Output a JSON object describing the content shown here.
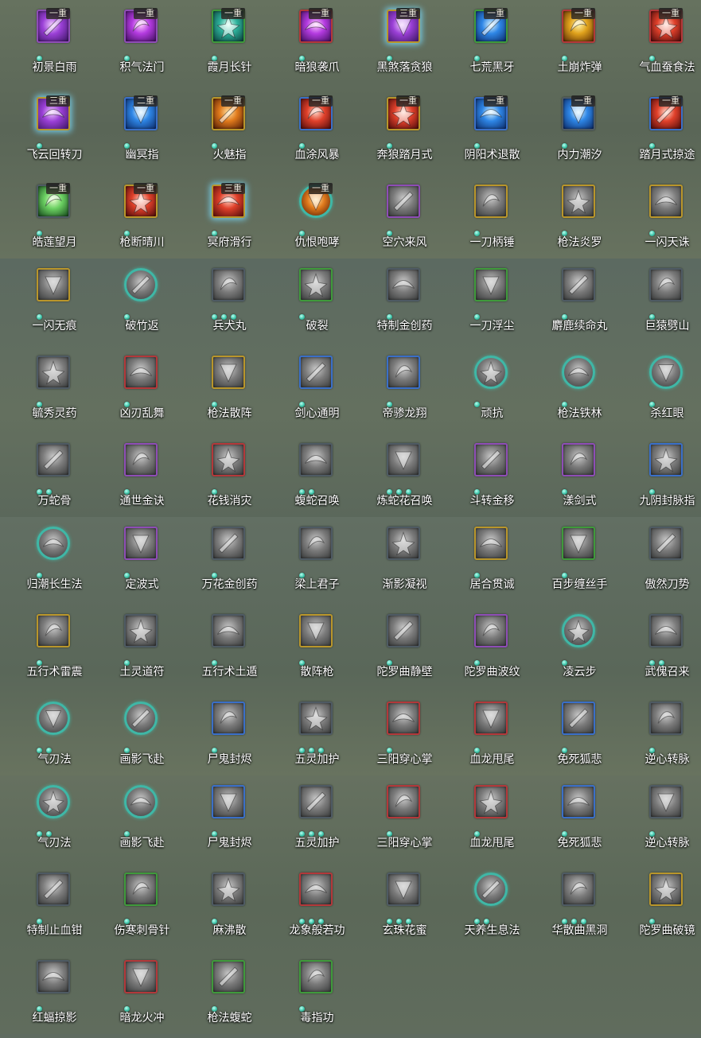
{
  "skills": [
    {
      "name": "初景白雨",
      "rank": "一重",
      "dots": 1,
      "border": "purple",
      "tone": "c-purple",
      "shape": "round-blank",
      "glow": false
    },
    {
      "name": "积气法门",
      "rank": "一重",
      "dots": 1,
      "border": "purple",
      "tone": "c-magenta",
      "glow": false
    },
    {
      "name": "霞月长针",
      "rank": "一重",
      "dots": 1,
      "border": "green",
      "tone": "c-teal",
      "glow": false
    },
    {
      "name": "暗狼袭爪",
      "rank": "一重",
      "dots": 1,
      "border": "red",
      "tone": "c-magenta",
      "glow": false
    },
    {
      "name": "黑煞落贪狼",
      "rank": "三重",
      "dots": 1,
      "border": "gold",
      "tone": "c-purple",
      "glow": true
    },
    {
      "name": "七荒黑牙",
      "rank": "一重",
      "dots": 1,
      "border": "green",
      "tone": "c-blue",
      "glow": false
    },
    {
      "name": "土崩炸弹",
      "rank": "一重",
      "dots": 1,
      "border": "red",
      "tone": "c-gold",
      "glow": false
    },
    {
      "name": "气血蚕食法",
      "rank": "一重",
      "dots": 1,
      "border": "red",
      "tone": "c-red",
      "glow": false
    },
    {
      "name": "飞云回转刀",
      "rank": "三重",
      "dots": 1,
      "border": "gold",
      "tone": "c-purple",
      "glow": true
    },
    {
      "name": "幽冥指",
      "rank": "二重",
      "dots": 1,
      "border": "blue",
      "tone": "c-blue",
      "glow": false
    },
    {
      "name": "火魅指",
      "rank": "一重",
      "dots": 1,
      "border": "gold",
      "tone": "c-orange",
      "glow": false
    },
    {
      "name": "血涂风暴",
      "rank": "一重",
      "dots": 1,
      "border": "blue",
      "tone": "c-red",
      "glow": false
    },
    {
      "name": "奔狼踏月式",
      "rank": "一重",
      "dots": 1,
      "border": "gold",
      "tone": "c-red",
      "glow": false
    },
    {
      "name": "阴阳术退散",
      "rank": "一重",
      "dots": 1,
      "border": "blue",
      "tone": "c-blue",
      "glow": false
    },
    {
      "name": "内力潮汐",
      "rank": "一重",
      "dots": 1,
      "border": "gray",
      "tone": "c-blue",
      "glow": false
    },
    {
      "name": "踏月式掠途",
      "rank": "一重",
      "dots": 1,
      "border": "blue",
      "tone": "c-red",
      "glow": false
    },
    {
      "name": "皓莲望月",
      "rank": "一重",
      "dots": 1,
      "border": "gray",
      "tone": "c-green",
      "glow": false
    },
    {
      "name": "枪断晴川",
      "rank": "一重",
      "dots": 1,
      "border": "gold",
      "tone": "c-red",
      "glow": false
    },
    {
      "name": "冥府滑行",
      "rank": "三重",
      "dots": 1,
      "border": "gold",
      "tone": "c-red",
      "glow": true
    },
    {
      "name": "仇恨咆哮",
      "rank": "一重",
      "dots": 1,
      "border": "round",
      "tone": "c-orange",
      "glow": false
    },
    {
      "name": "空穴来风",
      "rank": "",
      "dots": 1,
      "border": "purple",
      "tone": "",
      "glow": false
    },
    {
      "name": "一刀柄锤",
      "rank": "",
      "dots": 1,
      "border": "gold",
      "tone": "",
      "glow": false
    },
    {
      "name": "枪法炎罗",
      "rank": "",
      "dots": 1,
      "border": "gold",
      "tone": "",
      "glow": false
    },
    {
      "name": "一闪天诛",
      "rank": "",
      "dots": 1,
      "border": "gold",
      "tone": "",
      "glow": false
    },
    {
      "name": "一闪无痕",
      "rank": "",
      "dots": 1,
      "border": "gold",
      "tone": "",
      "glow": false
    },
    {
      "name": "破竹返",
      "rank": "",
      "dots": 1,
      "border": "round",
      "tone": "",
      "glow": false
    },
    {
      "name": "兵犬丸",
      "rank": "",
      "dots": 3,
      "border": "gray",
      "tone": "",
      "glow": false
    },
    {
      "name": "破裂",
      "rank": "",
      "dots": 1,
      "border": "green",
      "tone": "",
      "glow": false
    },
    {
      "name": "特制金创药",
      "rank": "",
      "dots": 1,
      "border": "gray",
      "tone": "",
      "glow": false
    },
    {
      "name": "一刀浮尘",
      "rank": "",
      "dots": 1,
      "border": "green",
      "tone": "",
      "glow": false
    },
    {
      "name": "麝鹿续命丸",
      "rank": "",
      "dots": 1,
      "border": "gray",
      "tone": "",
      "glow": false
    },
    {
      "name": "巨猿劈山",
      "rank": "",
      "dots": 1,
      "border": "gray",
      "tone": "",
      "glow": false
    },
    {
      "name": "毓秀灵药",
      "rank": "",
      "dots": 1,
      "border": "gray",
      "tone": "",
      "glow": false
    },
    {
      "name": "凶刃乱舞",
      "rank": "",
      "dots": 1,
      "border": "red",
      "tone": "",
      "glow": false
    },
    {
      "name": "枪法散阵",
      "rank": "",
      "dots": 1,
      "border": "gold",
      "tone": "",
      "glow": false
    },
    {
      "name": "剑心通明",
      "rank": "",
      "dots": 1,
      "border": "blue",
      "tone": "",
      "glow": false
    },
    {
      "name": "帝骖龙翔",
      "rank": "",
      "dots": 1,
      "border": "blue",
      "tone": "",
      "glow": false
    },
    {
      "name": "顽抗",
      "rank": "",
      "dots": 1,
      "border": "round",
      "tone": "",
      "glow": false
    },
    {
      "name": "枪法铁林",
      "rank": "",
      "dots": 1,
      "border": "round",
      "tone": "",
      "glow": false
    },
    {
      "name": "杀红眼",
      "rank": "",
      "dots": 1,
      "border": "round",
      "tone": "",
      "glow": false
    },
    {
      "name": "万蛇骨",
      "rank": "",
      "dots": 2,
      "border": "gray",
      "tone": "",
      "glow": false
    },
    {
      "name": "通世金诀",
      "rank": "",
      "dots": 1,
      "border": "purple",
      "tone": "",
      "glow": false
    },
    {
      "name": "花钱消灾",
      "rank": "",
      "dots": 1,
      "border": "red",
      "tone": "",
      "glow": false
    },
    {
      "name": "蝮蛇召唤",
      "rank": "",
      "dots": 2,
      "border": "gray",
      "tone": "",
      "glow": false
    },
    {
      "name": "炼蛇花召唤",
      "rank": "",
      "dots": 3,
      "border": "gray",
      "tone": "",
      "glow": false
    },
    {
      "name": "斗转金移",
      "rank": "",
      "dots": 1,
      "border": "purple",
      "tone": "",
      "glow": false
    },
    {
      "name": "漾剑式",
      "rank": "",
      "dots": 1,
      "border": "purple",
      "tone": "",
      "glow": false
    },
    {
      "name": "九阴封脉指",
      "rank": "",
      "dots": 1,
      "border": "blue",
      "tone": "",
      "glow": false
    },
    {
      "name": "归潮长生法",
      "rank": "",
      "dots": 1,
      "border": "round",
      "tone": "",
      "glow": false
    },
    {
      "name": "定波式",
      "rank": "",
      "dots": 1,
      "border": "purple",
      "tone": "",
      "glow": false
    },
    {
      "name": "万花金创药",
      "rank": "",
      "dots": 1,
      "border": "gray",
      "tone": "",
      "glow": false
    },
    {
      "name": "梁上君子",
      "rank": "",
      "dots": 1,
      "border": "gray",
      "tone": "",
      "glow": false
    },
    {
      "name": "渐影凝视",
      "rank": "",
      "dots": 0,
      "border": "gray",
      "tone": "",
      "glow": false
    },
    {
      "name": "居合贯诚",
      "rank": "",
      "dots": 1,
      "border": "gold",
      "tone": "",
      "glow": false
    },
    {
      "name": "百步缠丝手",
      "rank": "",
      "dots": 1,
      "border": "green",
      "tone": "",
      "glow": false
    },
    {
      "name": "傲然刀势",
      "rank": "",
      "dots": 0,
      "border": "gray",
      "tone": "",
      "glow": false
    },
    {
      "name": "五行术雷震",
      "rank": "",
      "dots": 1,
      "border": "gold",
      "tone": "",
      "glow": false
    },
    {
      "name": "土灵道符",
      "rank": "",
      "dots": 1,
      "border": "gray",
      "tone": "",
      "glow": false
    },
    {
      "name": "五行术土遁",
      "rank": "",
      "dots": 1,
      "border": "gray",
      "tone": "",
      "glow": false
    },
    {
      "name": "散阵枪",
      "rank": "",
      "dots": 1,
      "border": "gold",
      "tone": "",
      "glow": false
    },
    {
      "name": "陀罗曲静壁",
      "rank": "",
      "dots": 1,
      "border": "gray",
      "tone": "",
      "glow": false
    },
    {
      "name": "陀罗曲波纹",
      "rank": "",
      "dots": 1,
      "border": "purple",
      "tone": "",
      "glow": false
    },
    {
      "name": "凌云步",
      "rank": "",
      "dots": 1,
      "border": "round",
      "tone": "",
      "glow": false
    },
    {
      "name": "武傀召来",
      "rank": "",
      "dots": 2,
      "border": "gray",
      "tone": "",
      "glow": false
    },
    {
      "name": "气刃法",
      "rank": "",
      "dots": 2,
      "border": "round",
      "tone": "",
      "glow": false
    },
    {
      "name": "画影飞赴",
      "rank": "",
      "dots": 1,
      "border": "round",
      "tone": "",
      "glow": false
    },
    {
      "name": "尸鬼封烬",
      "rank": "",
      "dots": 1,
      "border": "blue",
      "tone": "",
      "glow": false
    },
    {
      "name": "五灵加护",
      "rank": "",
      "dots": 3,
      "border": "gray",
      "tone": "",
      "glow": false
    },
    {
      "name": "三阳穿心掌",
      "rank": "",
      "dots": 1,
      "border": "red",
      "tone": "",
      "glow": false
    },
    {
      "name": "血龙甩尾",
      "rank": "",
      "dots": 1,
      "border": "red",
      "tone": "",
      "glow": false
    },
    {
      "name": "免死狐悲",
      "rank": "",
      "dots": 1,
      "border": "blue",
      "tone": "",
      "glow": false
    },
    {
      "name": "逆心转脉",
      "rank": "",
      "dots": 1,
      "border": "gray",
      "tone": "",
      "glow": false
    },
    {
      "name": "气刃法",
      "rank": "",
      "dots": 2,
      "border": "round",
      "tone": "",
      "glow": false
    },
    {
      "name": "画影飞赴",
      "rank": "",
      "dots": 1,
      "border": "round",
      "tone": "",
      "glow": false
    },
    {
      "name": "尸鬼封烬",
      "rank": "",
      "dots": 1,
      "border": "blue",
      "tone": "",
      "glow": false
    },
    {
      "name": "五灵加护",
      "rank": "",
      "dots": 3,
      "border": "gray",
      "tone": "",
      "glow": false
    },
    {
      "name": "三阳穿心掌",
      "rank": "",
      "dots": 1,
      "border": "red",
      "tone": "",
      "glow": false
    },
    {
      "name": "血龙甩尾",
      "rank": "",
      "dots": 1,
      "border": "red",
      "tone": "",
      "glow": false
    },
    {
      "name": "免死狐悲",
      "rank": "",
      "dots": 1,
      "border": "blue",
      "tone": "",
      "glow": false
    },
    {
      "name": "逆心转脉",
      "rank": "",
      "dots": 1,
      "border": "gray",
      "tone": "",
      "glow": false
    },
    {
      "name": "特制止血钳",
      "rank": "",
      "dots": 1,
      "border": "gray",
      "tone": "",
      "glow": false
    },
    {
      "name": "伤寒刺骨针",
      "rank": "",
      "dots": 1,
      "border": "green",
      "tone": "",
      "glow": false
    },
    {
      "name": "麻沸散",
      "rank": "",
      "dots": 1,
      "border": "gray",
      "tone": "",
      "glow": false
    },
    {
      "name": "龙象般若功",
      "rank": "",
      "dots": 3,
      "border": "red",
      "tone": "",
      "glow": false
    },
    {
      "name": "玄珠花蜜",
      "rank": "",
      "dots": 3,
      "border": "gray",
      "tone": "",
      "glow": false
    },
    {
      "name": "天养生息法",
      "rank": "",
      "dots": 2,
      "border": "round",
      "tone": "",
      "glow": false
    },
    {
      "name": "华散曲黑洞",
      "rank": "",
      "dots": 3,
      "border": "gray",
      "tone": "",
      "glow": false
    },
    {
      "name": "陀罗曲破镜",
      "rank": "",
      "dots": 1,
      "border": "gold",
      "tone": "",
      "glow": false
    },
    {
      "name": "红蝠掠影",
      "rank": "",
      "dots": 1,
      "border": "gray",
      "tone": "",
      "glow": false
    },
    {
      "name": "暗龙火冲",
      "rank": "",
      "dots": 1,
      "border": "red",
      "tone": "",
      "glow": false
    },
    {
      "name": "枪法蝮蛇",
      "rank": "",
      "dots": 1,
      "border": "green",
      "tone": "",
      "glow": false
    },
    {
      "name": "毒指功",
      "rank": "",
      "dots": 1,
      "border": "green",
      "tone": "",
      "glow": false
    }
  ]
}
